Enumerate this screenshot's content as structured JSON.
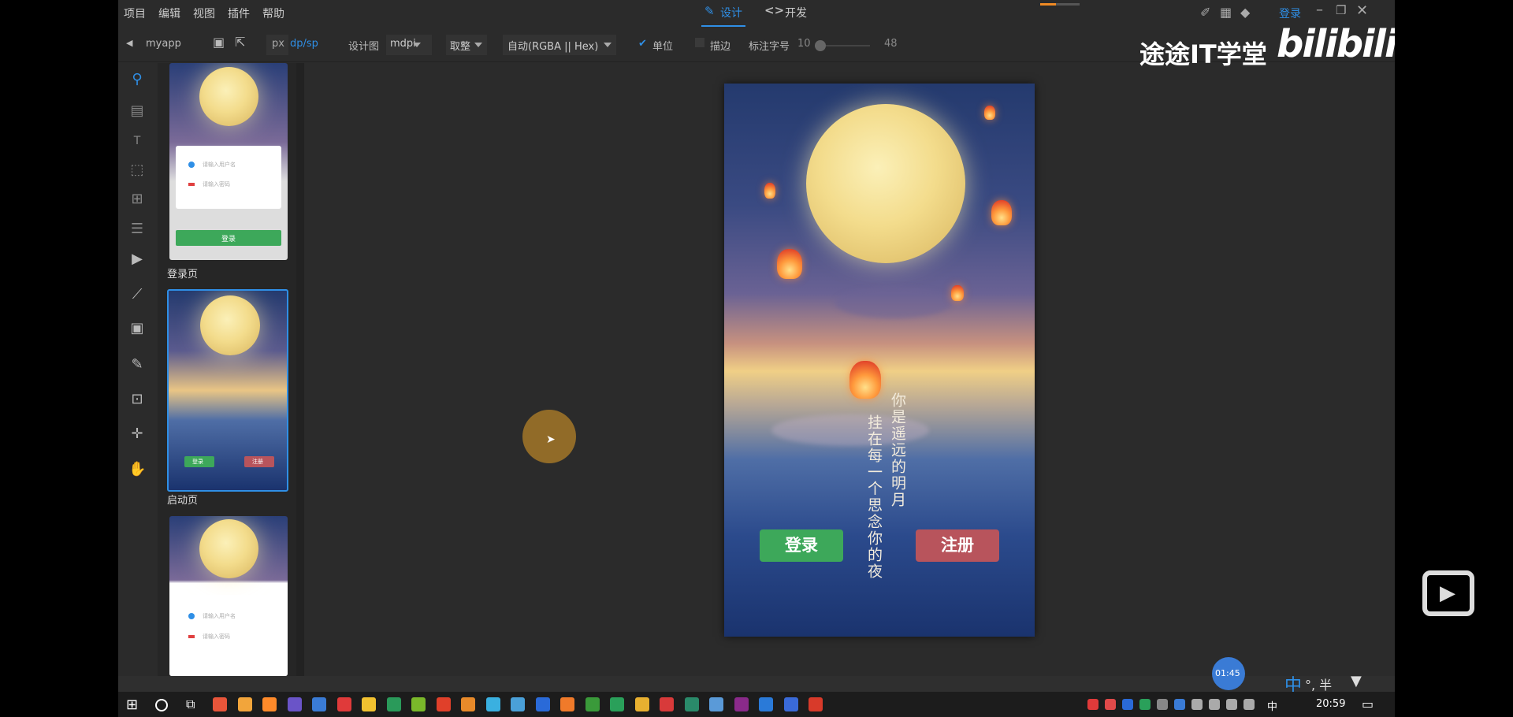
{
  "menu": {
    "project": "项目",
    "edit": "编辑",
    "view": "视图",
    "plugin": "插件",
    "help": "帮助"
  },
  "modes": {
    "design": "设计",
    "develop": "开发"
  },
  "account": {
    "login": "登录"
  },
  "toolbar": {
    "app_name": "myapp",
    "unit_px": "px",
    "unit_dp": "dp/sp",
    "design_label": "设计图",
    "density": "mdpi",
    "rounding": "取整",
    "color_format": "自动(RGBA || Hex)",
    "unit_check": "单位",
    "stroke_check": "描边",
    "font_label": "标注字号",
    "font_min": "10",
    "font_max": "48"
  },
  "pages": [
    {
      "label": "登录页",
      "username_placeholder": "请输入用户名",
      "password_placeholder": "请输入密码",
      "login_btn": "登录"
    },
    {
      "label": "启动页",
      "login_btn": "登录",
      "register_btn": "注册"
    },
    {
      "label": "",
      "username_placeholder": "请输入用户名",
      "password_placeholder": "请输入密码"
    }
  ],
  "phone": {
    "poem_line1": "你是遥远的明月",
    "poem_line2": "挂在每一个思念你的夜",
    "login_btn": "登录",
    "register_btn": "注册",
    "colors": {
      "login": "#3da85a",
      "register": "#b8545c"
    }
  },
  "watermark": {
    "channel": "途途IT学堂",
    "site": "bilibili"
  },
  "player": {
    "time": "01:45"
  },
  "ime": {
    "mode": "中",
    "half": "°, 半"
  },
  "taskbar": {
    "clock": "20:59",
    "lang": "中"
  }
}
